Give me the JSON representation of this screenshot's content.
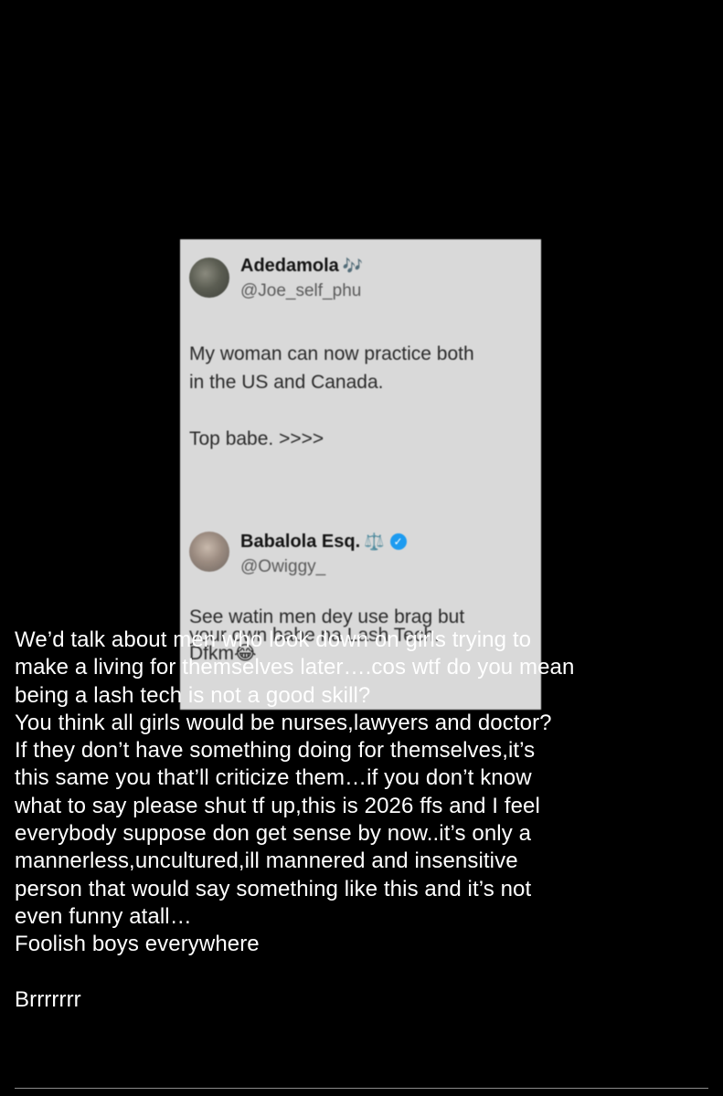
{
  "tweet_card": {
    "original": {
      "name": "Adedamola",
      "name_emoji": "🎶",
      "handle": "@Joe_self_phu",
      "body": "My woman can now practice both\nin the US and Canada.\n\nTop babe. >>>>"
    },
    "reply": {
      "name": "Babalola Esq.",
      "name_emoji": "⚖️",
      "verified_mark": "✓",
      "handle": "@Owiggy_",
      "body": "See watin men dey use brag but\nyour own babe na Lash Tech.\nDfkm😂"
    }
  },
  "caption": {
    "text": "We’d talk about men who look down on girls trying to\nmake a living for themselves later….cos wtf do you mean\nbeing a lash tech is not a good skill?\nYou think all girls would be nurses,lawyers and doctor?\nIf they don’t have something doing for themselves,it’s\nthis same you that’ll criticize them…if you don’t know\nwhat to say please shut tf up,this is 2026 ffs and I feel\neverybody suppose don get sense by now..it’s only a\nmannerless,uncultured,ill mannered and insensitive\nperson that would say something like this and it’s not\neven funny atall…\nFoolish boys everywhere\n\nBrrrrrrr"
  },
  "colors": {
    "background": "#000000",
    "card": "#d9d9d9",
    "caption_text": "#ffffff",
    "verified": "#1d9bf0"
  }
}
